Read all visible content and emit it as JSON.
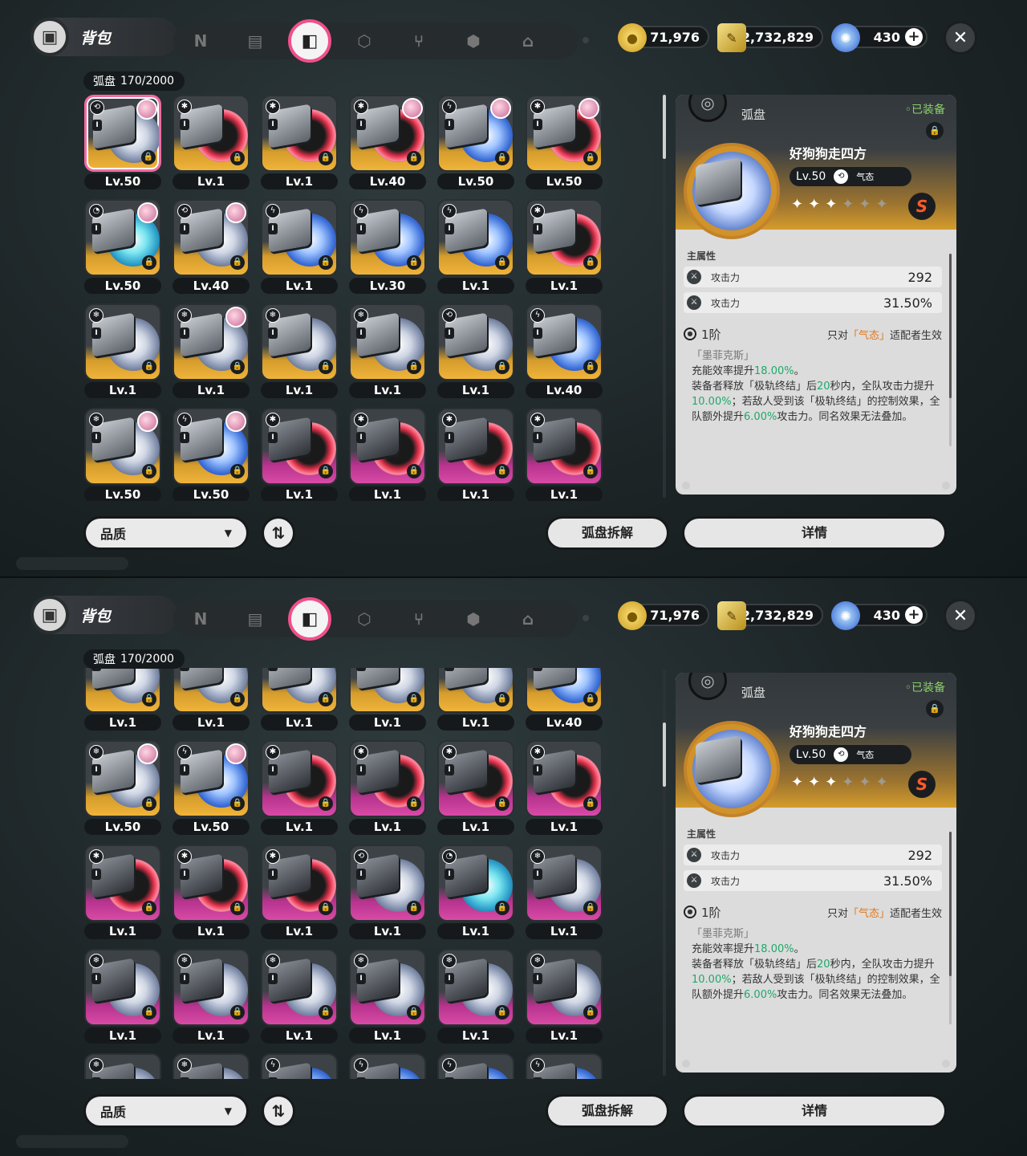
{
  "header": {
    "title": "背包",
    "tabs": [
      {
        "icon": "n-logo-icon",
        "glyph": "N"
      },
      {
        "icon": "gameboy-icon",
        "glyph": "▤"
      },
      {
        "icon": "disc-case-icon",
        "glyph": "◧",
        "active": true
      },
      {
        "icon": "cube-icon",
        "glyph": "⬡"
      },
      {
        "icon": "fork-knife-icon",
        "glyph": "⑂"
      },
      {
        "icon": "hexagon-chip-icon",
        "glyph": "⬢"
      },
      {
        "icon": "house-icon",
        "glyph": "⌂"
      }
    ]
  },
  "currency": {
    "coins": "71,976",
    "tickets": "2,732,829",
    "polychrome": "430",
    "close_glyph": "✕"
  },
  "inventory": {
    "label": "弧盘",
    "count": "170/2000"
  },
  "panel1_rows": [
    [
      {
        "lv": "Lv.50",
        "attr": "⟲",
        "c": "gold",
        "d": "silver",
        "av": true,
        "sel": true
      },
      {
        "lv": "Lv.1",
        "attr": "✱",
        "c": "gold",
        "d": "red",
        "av": false
      },
      {
        "lv": "Lv.1",
        "attr": "✱",
        "c": "gold",
        "d": "red",
        "av": false
      },
      {
        "lv": "Lv.40",
        "attr": "✱",
        "c": "gold",
        "d": "red",
        "av": true
      },
      {
        "lv": "Lv.50",
        "attr": "ϟ",
        "c": "gold",
        "d": "blue",
        "av": true
      },
      {
        "lv": "Lv.50",
        "attr": "✱",
        "c": "gold",
        "d": "red",
        "av": true
      }
    ],
    [
      {
        "lv": "Lv.50",
        "attr": "◔",
        "c": "gold",
        "d": "cyan",
        "av": true
      },
      {
        "lv": "Lv.40",
        "attr": "⟲",
        "c": "gold",
        "d": "silver",
        "av": true
      },
      {
        "lv": "Lv.1",
        "attr": "ϟ",
        "c": "gold",
        "d": "blue",
        "av": false
      },
      {
        "lv": "Lv.30",
        "attr": "ϟ",
        "c": "gold",
        "d": "blue",
        "av": false
      },
      {
        "lv": "Lv.1",
        "attr": "ϟ",
        "c": "gold",
        "d": "blue",
        "av": false
      },
      {
        "lv": "Lv.1",
        "attr": "✱",
        "c": "gold",
        "d": "red",
        "av": false
      }
    ],
    [
      {
        "lv": "Lv.1",
        "attr": "❄",
        "c": "gold",
        "d": "silver",
        "av": false
      },
      {
        "lv": "Lv.1",
        "attr": "❄",
        "c": "gold",
        "d": "silver",
        "av": true
      },
      {
        "lv": "Lv.1",
        "attr": "❄",
        "c": "gold",
        "d": "silver",
        "av": false
      },
      {
        "lv": "Lv.1",
        "attr": "❄",
        "c": "gold",
        "d": "silver",
        "av": false
      },
      {
        "lv": "Lv.1",
        "attr": "⟲",
        "c": "gold",
        "d": "silver",
        "av": false
      },
      {
        "lv": "Lv.40",
        "attr": "ϟ",
        "c": "gold",
        "d": "blue",
        "av": false
      }
    ],
    [
      {
        "lv": "Lv.50",
        "attr": "❄",
        "c": "gold",
        "d": "silver",
        "av": true
      },
      {
        "lv": "Lv.50",
        "attr": "ϟ",
        "c": "gold",
        "d": "blue",
        "av": true
      },
      {
        "lv": "Lv.1",
        "attr": "✱",
        "c": "purple",
        "d": "red",
        "av": false
      },
      {
        "lv": "Lv.1",
        "attr": "✱",
        "c": "purple",
        "d": "red",
        "av": false
      },
      {
        "lv": "Lv.1",
        "attr": "✱",
        "c": "purple",
        "d": "red",
        "av": false
      },
      {
        "lv": "Lv.1",
        "attr": "✱",
        "c": "purple",
        "d": "red",
        "av": false
      }
    ]
  ],
  "panel2_rows": [
    [
      {
        "lv": "Lv.1",
        "attr": "❄",
        "c": "gold",
        "d": "silver",
        "av": false
      },
      {
        "lv": "Lv.1",
        "attr": "❄",
        "c": "gold",
        "d": "silver",
        "av": false
      },
      {
        "lv": "Lv.1",
        "attr": "❄",
        "c": "gold",
        "d": "silver",
        "av": false
      },
      {
        "lv": "Lv.1",
        "attr": "❄",
        "c": "gold",
        "d": "silver",
        "av": false
      },
      {
        "lv": "Lv.1",
        "attr": "⟲",
        "c": "gold",
        "d": "silver",
        "av": false
      },
      {
        "lv": "Lv.40",
        "attr": "ϟ",
        "c": "gold",
        "d": "blue",
        "av": false
      }
    ],
    [
      {
        "lv": "Lv.50",
        "attr": "❄",
        "c": "gold",
        "d": "silver",
        "av": true
      },
      {
        "lv": "Lv.50",
        "attr": "ϟ",
        "c": "gold",
        "d": "blue",
        "av": true
      },
      {
        "lv": "Lv.1",
        "attr": "✱",
        "c": "purple",
        "d": "red",
        "av": false
      },
      {
        "lv": "Lv.1",
        "attr": "✱",
        "c": "purple",
        "d": "red",
        "av": false
      },
      {
        "lv": "Lv.1",
        "attr": "✱",
        "c": "purple",
        "d": "red",
        "av": false
      },
      {
        "lv": "Lv.1",
        "attr": "✱",
        "c": "purple",
        "d": "red",
        "av": false
      }
    ],
    [
      {
        "lv": "Lv.1",
        "attr": "✱",
        "c": "purple",
        "d": "red",
        "av": false
      },
      {
        "lv": "Lv.1",
        "attr": "✱",
        "c": "purple",
        "d": "red",
        "av": false
      },
      {
        "lv": "Lv.1",
        "attr": "✱",
        "c": "purple",
        "d": "red",
        "av": false
      },
      {
        "lv": "Lv.1",
        "attr": "⟲",
        "c": "purple",
        "d": "silver",
        "av": false
      },
      {
        "lv": "Lv.1",
        "attr": "◔",
        "c": "purple",
        "d": "cyan",
        "av": false
      },
      {
        "lv": "Lv.1",
        "attr": "❄",
        "c": "purple",
        "d": "silver",
        "av": false
      }
    ],
    [
      {
        "lv": "Lv.1",
        "attr": "❄",
        "c": "purple",
        "d": "silver",
        "av": false
      },
      {
        "lv": "Lv.1",
        "attr": "❄",
        "c": "purple",
        "d": "silver",
        "av": false
      },
      {
        "lv": "Lv.1",
        "attr": "❄",
        "c": "purple",
        "d": "silver",
        "av": false
      },
      {
        "lv": "Lv.1",
        "attr": "❄",
        "c": "purple",
        "d": "silver",
        "av": false
      },
      {
        "lv": "Lv.1",
        "attr": "❄",
        "c": "purple",
        "d": "silver",
        "av": false
      },
      {
        "lv": "Lv.1",
        "attr": "❄",
        "c": "purple",
        "d": "silver",
        "av": false
      }
    ],
    [
      {
        "lv": "",
        "attr": "❄",
        "c": "purple",
        "d": "silver",
        "av": false
      },
      {
        "lv": "",
        "attr": "❄",
        "c": "purple",
        "d": "silver",
        "av": false
      },
      {
        "lv": "",
        "attr": "ϟ",
        "c": "purple",
        "d": "blue",
        "av": false
      },
      {
        "lv": "",
        "attr": "ϟ",
        "c": "purple",
        "d": "blue",
        "av": false
      },
      {
        "lv": "",
        "attr": "ϟ",
        "c": "purple",
        "d": "blue",
        "av": false
      },
      {
        "lv": "",
        "attr": "ϟ",
        "c": "purple",
        "d": "blue",
        "av": false
      }
    ]
  ],
  "detail": {
    "category": "弧盘",
    "equipped": "◦已装备",
    "name": "好狗狗走四方",
    "level": "Lv.50",
    "attribute": "气态",
    "rank_badge": "S",
    "stars_filled": 3,
    "stars_total": 6,
    "main_attr_label": "主属性",
    "stats": [
      {
        "name": "攻击力",
        "value": "292"
      },
      {
        "name": "攻击力",
        "value": "31.50%"
      }
    ],
    "tier": "1阶",
    "restriction_pre": "只对",
    "restriction_attr": "「气态」",
    "restriction_post": "适配者生效",
    "source": "「墨菲克斯」",
    "desc_1_pre": "充能效率提升",
    "desc_1_val": "18.00%",
    "desc_1_post": "。",
    "desc_2_a": "装备者释放「极轨终结」后",
    "desc_2_b": "20",
    "desc_2_c": "秒内，全队攻击力提升",
    "desc_2_d": "10.00%",
    "desc_2_e": "；若敌人受到该「极轨终结」的控制效果，全队额外提升",
    "desc_2_f": "6.00%",
    "desc_2_g": "攻击力。同名效果无法叠加。"
  },
  "footer": {
    "quality_label": "品质",
    "sort_glyph": "⇅",
    "dismantle_label": "弧盘拆解",
    "details_label": "详情"
  },
  "colors": {
    "accent_pink": "#f0508a",
    "gold": "#f0b43a",
    "purple": "#d84aa6",
    "green": "#1fa86a",
    "orange": "#e0781c"
  }
}
